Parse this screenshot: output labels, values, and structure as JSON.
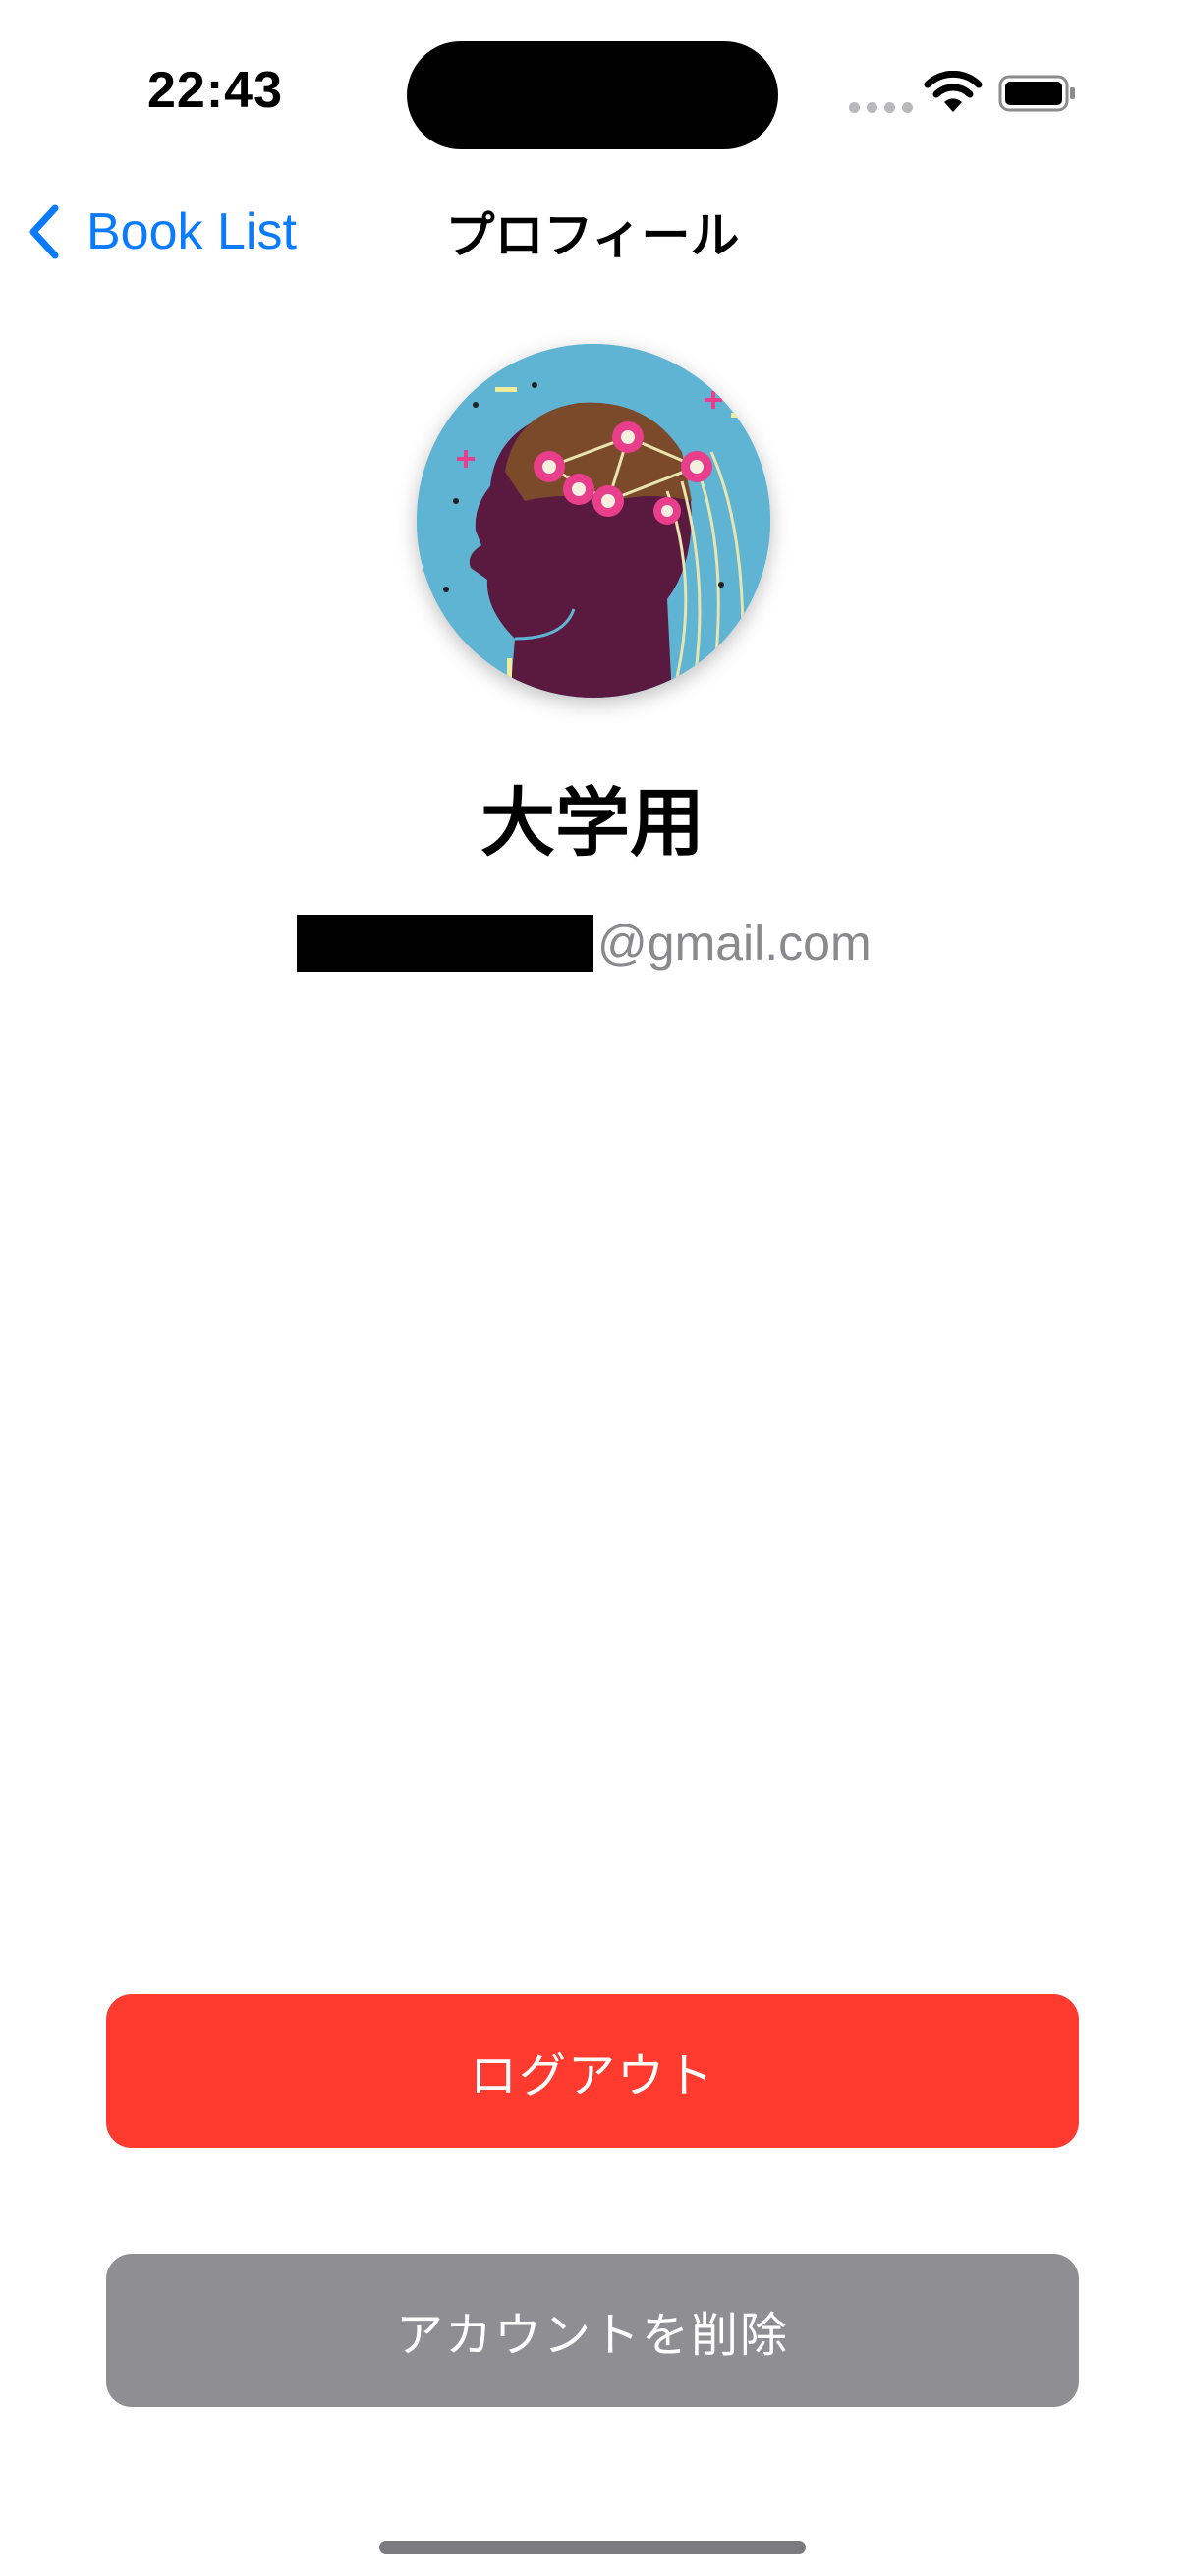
{
  "status_bar": {
    "time": "22:43"
  },
  "nav": {
    "back_label": "Book List",
    "title": "プロフィール"
  },
  "profile": {
    "name": "大学用",
    "email_domain": "@gmail.com",
    "email_local_redacted": true
  },
  "actions": {
    "logout_label": "ログアウト",
    "delete_label": "アカウントを削除"
  },
  "colors": {
    "accent": "#0a7aff",
    "logout_button": "#ff3b30",
    "delete_button": "#8e8e93",
    "avatar_background": "#5fb3d3",
    "avatar_silhouette": "#5a1a40"
  },
  "icons": {
    "back": "chevron-left-icon",
    "wifi": "wifi-icon",
    "battery": "battery-icon",
    "signal": "signal-dots-icon"
  }
}
